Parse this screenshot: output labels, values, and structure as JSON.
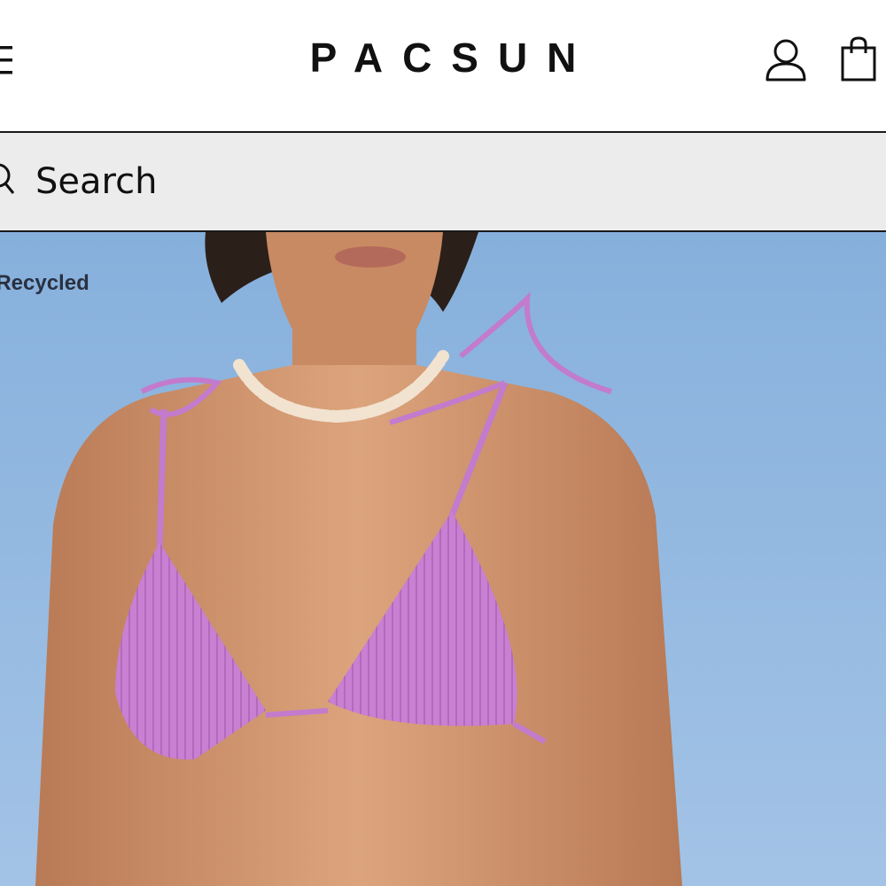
{
  "header": {
    "logo_text": "PACSUN",
    "menu_icon": "hamburger-menu-icon",
    "account_icon": "user-icon",
    "bag_icon": "shopping-bag-icon"
  },
  "search": {
    "placeholder": "Search",
    "icon": "search-icon"
  },
  "hero": {
    "caption": ", Recycled",
    "colors": {
      "sky": "#93b8e0",
      "skin": "#d49a72",
      "bikini": "#c77fd0"
    }
  }
}
